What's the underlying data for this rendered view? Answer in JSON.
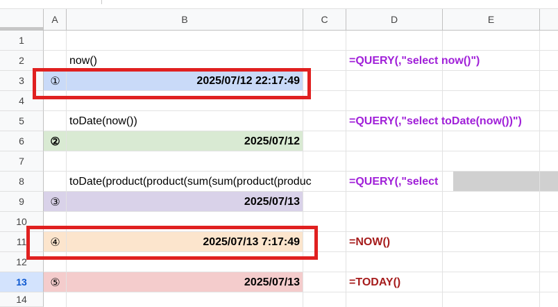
{
  "columns": [
    "A",
    "B",
    "C",
    "D",
    "E"
  ],
  "rows": [
    "1",
    "2",
    "3",
    "4",
    "5",
    "6",
    "7",
    "8",
    "9",
    "10",
    "11",
    "12",
    "13",
    "14"
  ],
  "selected_row": "13",
  "cells": {
    "b2": "now()",
    "a3": "①",
    "b3": "2025/07/12 22:17:49",
    "b5": "toDate(now())",
    "a6": "②",
    "b6": "2025/07/12",
    "b8": "toDate(product(product(sum(sum(product(produc",
    "a9": "③",
    "b9": "2025/07/13",
    "a11": "④",
    "b11": "2025/07/13 7:17:49",
    "a13": "⑤",
    "b13": "2025/07/13"
  },
  "formulas": {
    "d2": "=QUERY(,\"select now()\")",
    "d5": "=QUERY(,\"select toDate(now())\")",
    "d8": "=QUERY(,\"select",
    "d11": "=NOW()",
    "d13": "=TODAY()"
  },
  "colors": {
    "query_formula": "#a020d8",
    "builtin_formula": "#a61c1c",
    "row3_fill": "#c9daf8",
    "row6_fill": "#d9ead3",
    "row9_fill": "#d9d2e9",
    "row11_fill": "#fce5cd",
    "row13_fill": "#f4cccc",
    "highlight_box": "#e02020",
    "selected_row_header": "#d3e3fd"
  }
}
